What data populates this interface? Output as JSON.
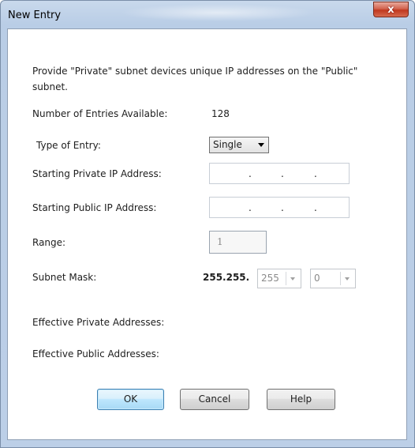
{
  "window": {
    "title": "New Entry",
    "close_label": "x"
  },
  "description": "Provide \"Private\" subnet devices unique IP addresses on the \"Public\" subnet.",
  "entries_available": {
    "label": "Number of Entries Available:",
    "value": "128"
  },
  "type_of_entry": {
    "label": "Type of Entry:",
    "value": "Single"
  },
  "private_ip": {
    "label": "Starting Private IP Address:",
    "dots": [
      ".",
      ".",
      "."
    ]
  },
  "public_ip": {
    "label": "Starting Public IP Address:",
    "dots": [
      ".",
      ".",
      "."
    ]
  },
  "range": {
    "label": "Range:",
    "value": "1"
  },
  "subnet_mask": {
    "label": "Subnet Mask:",
    "prefix": "255.255.",
    "octet3": "255",
    "octet4": "0"
  },
  "effective_private": {
    "label": "Effective Private Addresses:"
  },
  "effective_public": {
    "label": "Effective Public Addresses:"
  },
  "buttons": {
    "ok": "OK",
    "cancel": "Cancel",
    "help": "Help"
  }
}
